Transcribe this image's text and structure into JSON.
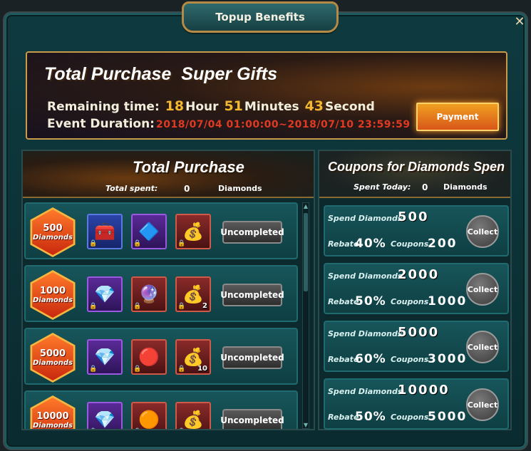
{
  "window": {
    "title": "Topup Benefits",
    "close_glyph": "✕"
  },
  "banner": {
    "title_part1": "Total Purchase",
    "title_part2": "Super Gifts",
    "remaining_label": "Remaining time:",
    "hours": "18",
    "hour_label": "Hour",
    "minutes": "51",
    "minutes_label": "Minutes",
    "seconds": "43",
    "seconds_label": "Second",
    "duration_label": "Event Duration:",
    "duration_value": "2018/07/04 01:00:00~2018/07/10 23:59:59",
    "payment_button": "Payment"
  },
  "total_purchase": {
    "title": "Total Purchase",
    "spent_label": "Total spent:",
    "spent_value": "0",
    "spent_unit": "Diamonds",
    "tiers": [
      {
        "amount": "500",
        "unit": "Diamonds",
        "button": "Uncompleted",
        "rewards": [
          {
            "icon": "treasure-chest-icon",
            "glyph": "🧰",
            "style": "blue",
            "count": ""
          },
          {
            "icon": "blue-gem-orb-icon",
            "glyph": "🔷",
            "style": "purple",
            "count": ""
          },
          {
            "icon": "gold-chest-icon",
            "glyph": "💰",
            "style": "red",
            "count": ""
          }
        ]
      },
      {
        "amount": "1000",
        "unit": "Diamonds",
        "button": "Uncompleted",
        "rewards": [
          {
            "icon": "gem-chest-icon",
            "glyph": "💎",
            "style": "purple",
            "count": ""
          },
          {
            "icon": "purple-rune-orb-icon",
            "glyph": "🔮",
            "style": "red",
            "count": ""
          },
          {
            "icon": "gold-chest-icon",
            "glyph": "💰",
            "style": "red",
            "count": "2"
          }
        ]
      },
      {
        "amount": "5000",
        "unit": "Diamonds",
        "button": "Uncompleted",
        "rewards": [
          {
            "icon": "gem-chest-icon",
            "glyph": "💎",
            "style": "purple",
            "count": ""
          },
          {
            "icon": "red-rune-orb-icon",
            "glyph": "🔴",
            "style": "red",
            "count": ""
          },
          {
            "icon": "gold-chest-icon",
            "glyph": "💰",
            "style": "red",
            "count": "10"
          }
        ]
      },
      {
        "amount": "10000",
        "unit": "Diamonds",
        "button": "Uncompleted",
        "rewards": [
          {
            "icon": "gem-chest-icon",
            "glyph": "💎",
            "style": "purple",
            "count": ""
          },
          {
            "icon": "bronze-rune-orb-icon",
            "glyph": "🟠",
            "style": "red",
            "count": ""
          },
          {
            "icon": "gold-chest-icon",
            "glyph": "💰",
            "style": "red",
            "count": ""
          }
        ]
      }
    ]
  },
  "coupons": {
    "title": "Coupons for Diamonds Spen",
    "spent_label": "Spent Today:",
    "spent_value": "0",
    "spent_unit": "Diamonds",
    "rows": [
      {
        "spend_label": "Spend Diamonds",
        "spend": "500",
        "rebate_label": "Rebate",
        "rebate": "40%",
        "coupons_label": "Coupons",
        "coupons": "200",
        "button": "Collect"
      },
      {
        "spend_label": "Spend Diamonds",
        "spend": "2000",
        "rebate_label": "Rebate",
        "rebate": "50%",
        "coupons_label": "Coupons",
        "coupons": "1000",
        "button": "Collect"
      },
      {
        "spend_label": "Spend Diamonds",
        "spend": "5000",
        "rebate_label": "Rebate",
        "rebate": "60%",
        "coupons_label": "Coupons",
        "coupons": "3000",
        "button": "Collect"
      },
      {
        "spend_label": "Spend Diamonds",
        "spend": "10000",
        "rebate_label": "Rebate",
        "rebate": "50%",
        "coupons_label": "Coupons",
        "coupons": "5000",
        "button": "Collect"
      }
    ]
  }
}
